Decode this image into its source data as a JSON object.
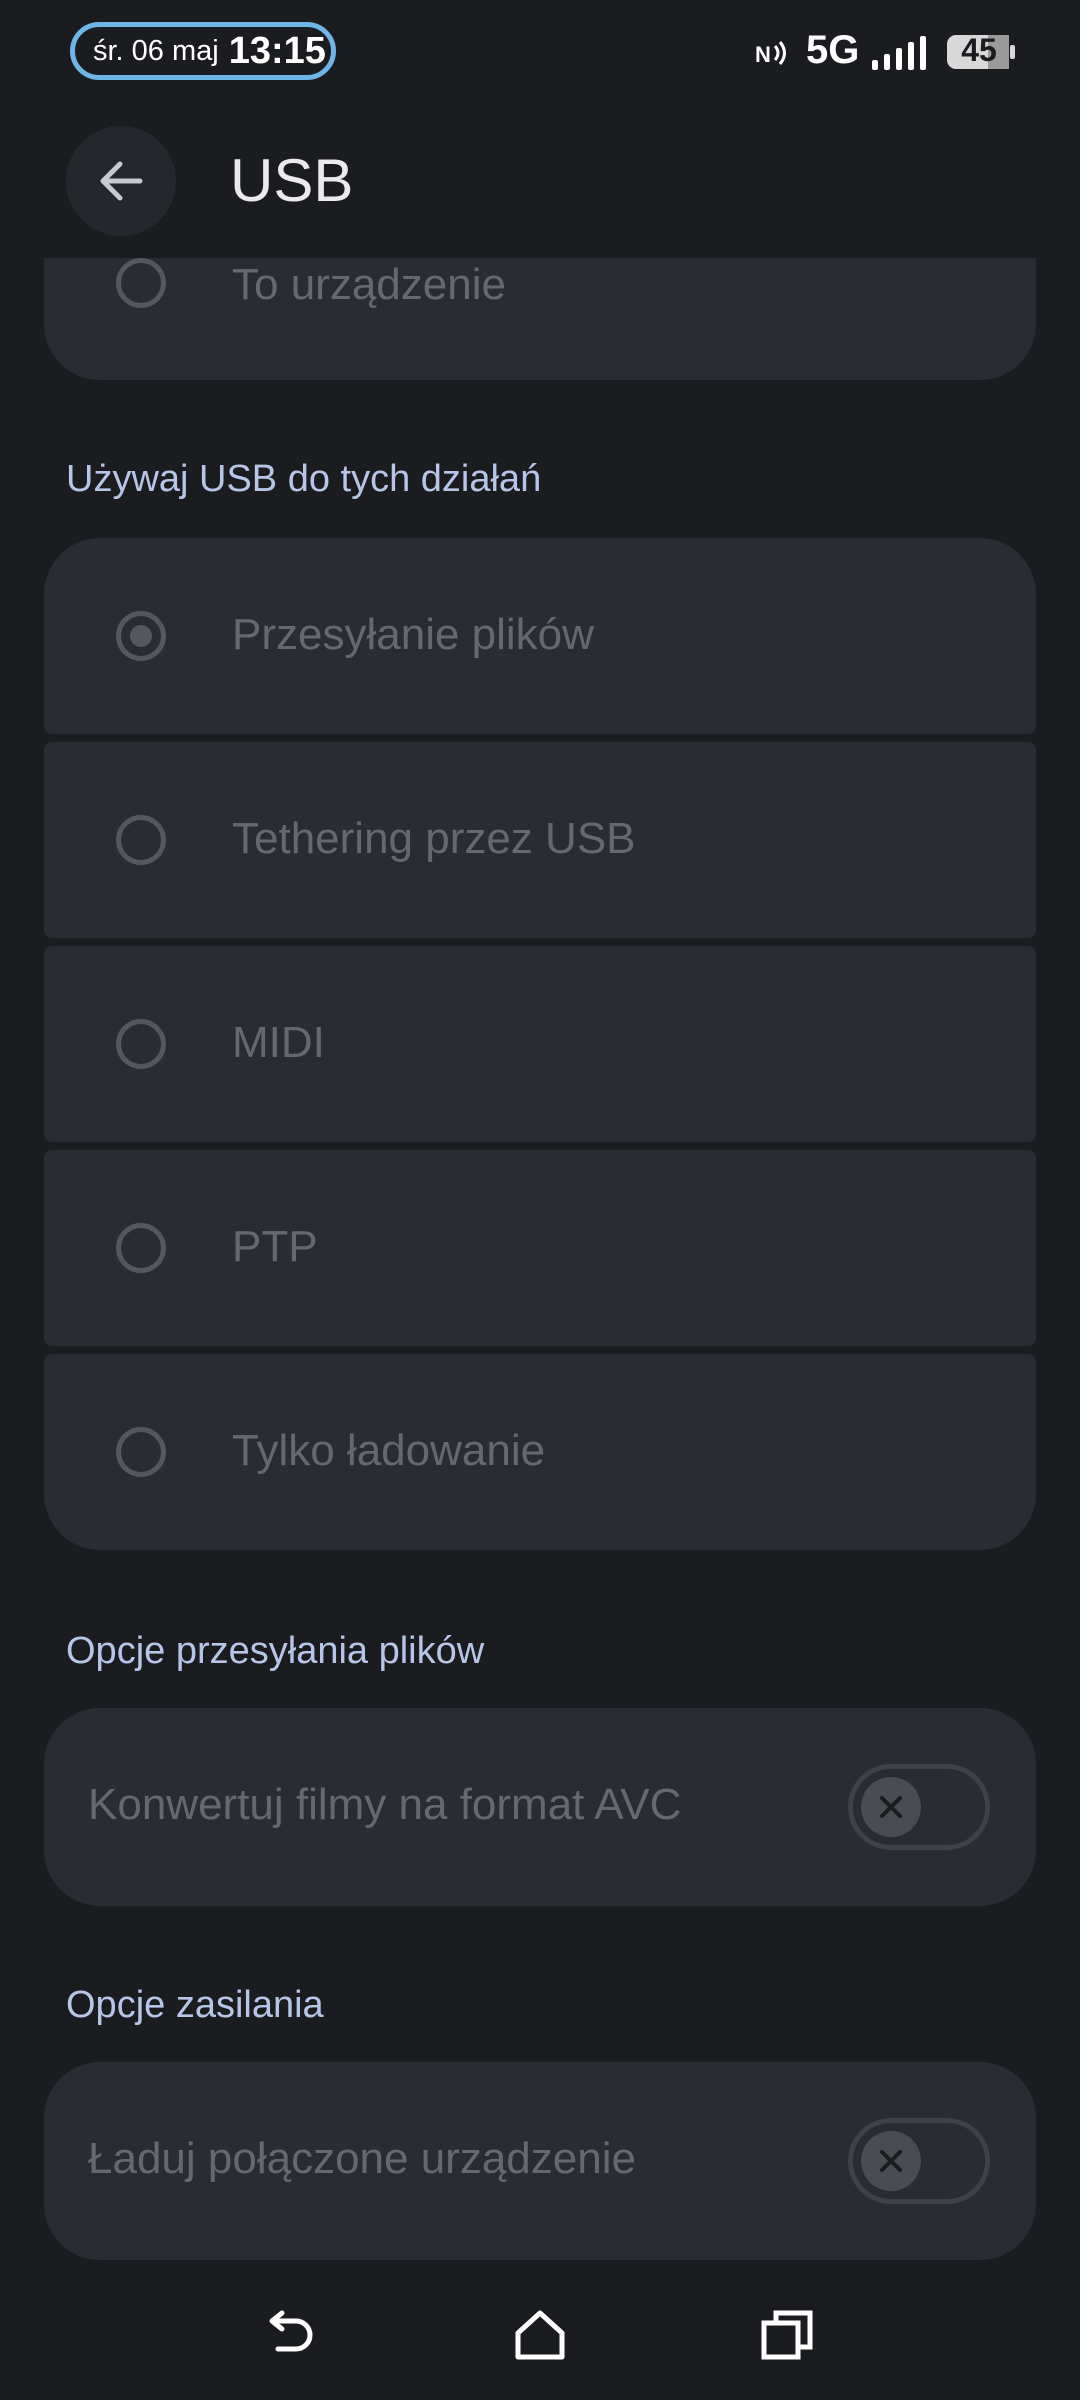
{
  "status_bar": {
    "date": "śr. 06 maj",
    "time": "13:15",
    "network": "5G",
    "battery": "45",
    "icons": [
      "nfc-icon",
      "signal-icon",
      "battery-icon"
    ]
  },
  "app_bar": {
    "title": "USB",
    "back_icon": "arrow-left-icon"
  },
  "top_card": {
    "label": "To urządzenie"
  },
  "usb_mode_section": {
    "header": "Używaj USB do tych działań",
    "options": [
      {
        "label": "Przesyłanie plików",
        "selected": true
      },
      {
        "label": "Tethering przez USB",
        "selected": false
      },
      {
        "label": "MIDI",
        "selected": false
      },
      {
        "label": "PTP",
        "selected": false
      },
      {
        "label": "Tylko ładowanie",
        "selected": false
      }
    ]
  },
  "file_transfer_section": {
    "header": "Opcje przesyłania plików",
    "toggle_label": "Konwertuj filmy na format AVC",
    "toggle_on": false
  },
  "power_section": {
    "header": "Opcje zasilania",
    "toggle_label": "Ładuj połączone urządzenie",
    "toggle_on": false
  },
  "nav_bar": {
    "icons": [
      "back-icon",
      "home-icon",
      "recents-icon"
    ]
  },
  "colors": {
    "background": "#1b1c20",
    "card": "#2a2c33",
    "section_header": "#b6c5e8",
    "pill_border": "#6fb6e8"
  }
}
